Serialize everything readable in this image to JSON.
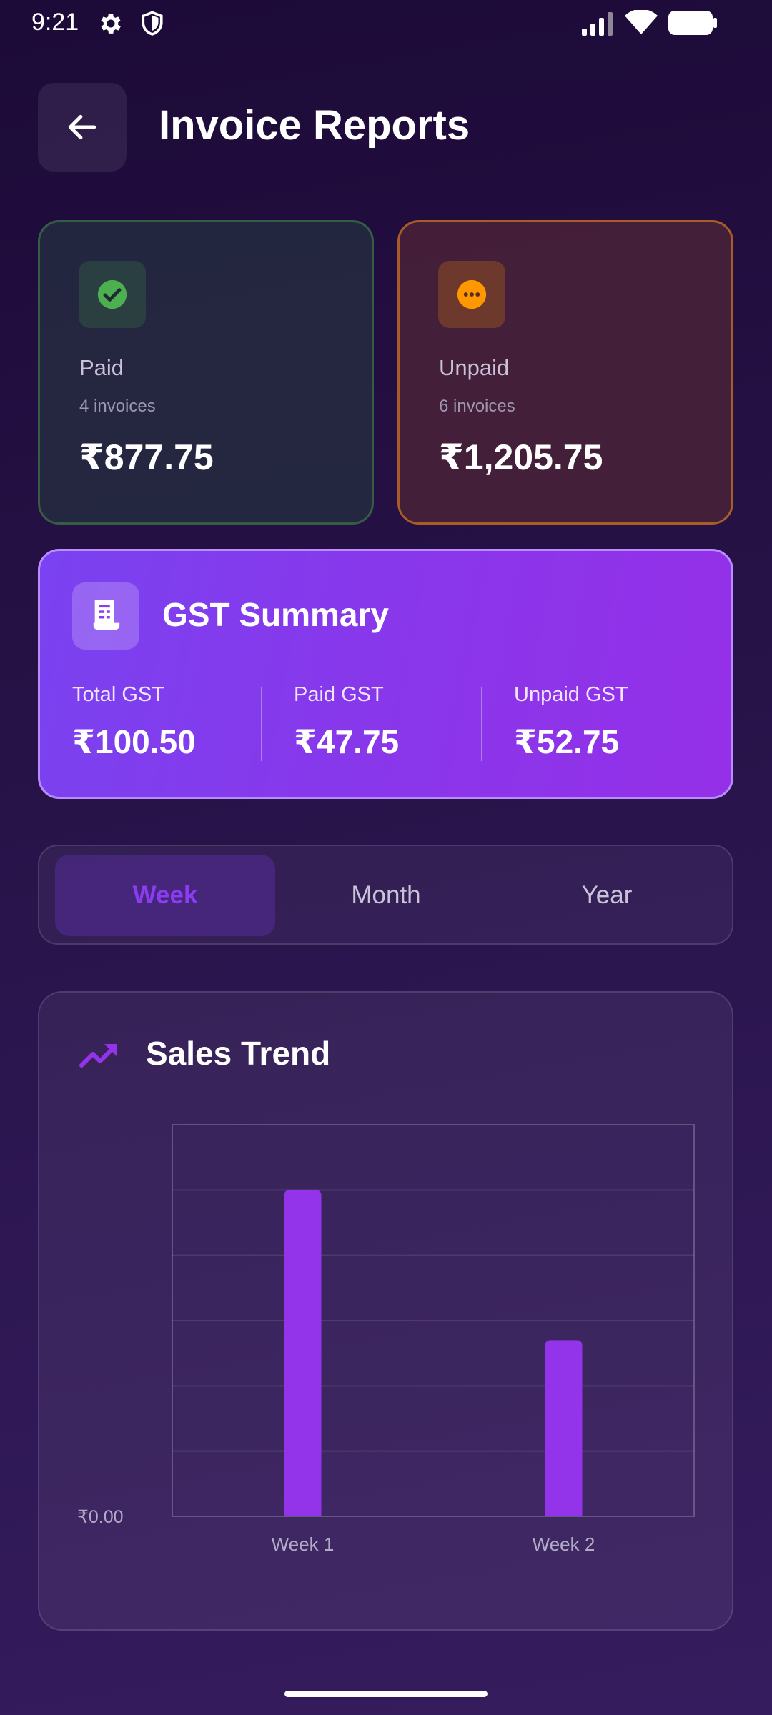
{
  "status_bar": {
    "time": "9:21"
  },
  "header": {
    "title": "Invoice Reports"
  },
  "summary": {
    "paid": {
      "label": "Paid",
      "count": "4 invoices",
      "amount": "₹877.75"
    },
    "unpaid": {
      "label": "Unpaid",
      "count": "6 invoices",
      "amount": "₹1,205.75"
    }
  },
  "gst": {
    "title": "GST Summary",
    "total_label": "Total GST",
    "total_value": "₹100.50",
    "paid_label": "Paid GST",
    "paid_value": "₹47.75",
    "unpaid_label": "Unpaid GST",
    "unpaid_value": "₹52.75"
  },
  "period_tabs": {
    "items": [
      "Week",
      "Month",
      "Year"
    ],
    "selected": "Week"
  },
  "sales_trend": {
    "title": "Sales Trend"
  },
  "chart_data": {
    "type": "bar",
    "categories": [
      "Week 1",
      "Week 2"
    ],
    "values": [
      1.0,
      0.54
    ],
    "value_scale": "relative to chart maximum (no y tick values shown except zero)",
    "y_tick_labels": [
      "₹0.00"
    ],
    "grid": true,
    "bar_color": "#9333ea"
  },
  "colors": {
    "accent": "#9333ea",
    "paid": "#4caf50",
    "unpaid": "#ff9800"
  }
}
